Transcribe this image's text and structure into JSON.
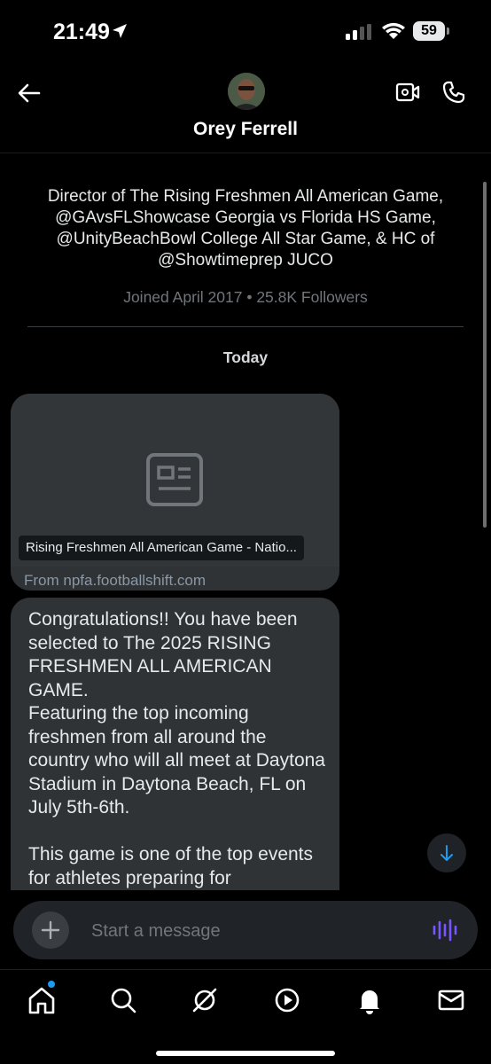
{
  "status_bar": {
    "time": "21:49",
    "battery": "59"
  },
  "header": {
    "contact_name": "Orey Ferrell"
  },
  "bio": {
    "description": "Director of The Rising Freshmen All American Game, @GAvsFLShowcase Georgia vs Florida HS Game, @UnityBeachBowl College All Star Game, & HC of @Showtimeprep JUCO",
    "joined": "Joined April 2017 • 25.8K Followers"
  },
  "conversation": {
    "day_label": "Today",
    "link_card": {
      "title": "Rising Freshmen All American Game - Natio...",
      "domain": "From npfa.footballshift.com"
    },
    "message": {
      "paragraph1": "Congratulations!!  You have been selected to The 2025 RISING FRESHMEN ALL AMERICAN GAME.",
      "paragraph2": "Featuring the top incoming freshmen from all around the country who will all meet at Daytona Stadium in Daytona Beach, FL on July 5th-6th.",
      "paragraph3": "This game is one of the top events for athletes preparing for"
    }
  },
  "composer": {
    "placeholder": "Start a message"
  },
  "tab_bar": {
    "items": [
      "home-icon",
      "search-icon",
      "grok-icon",
      "play-icon",
      "bell-icon",
      "mail-icon"
    ]
  },
  "colors": {
    "accent": "#1d9bf0",
    "bubble": "#2f3336",
    "voice": "#7856ff"
  }
}
